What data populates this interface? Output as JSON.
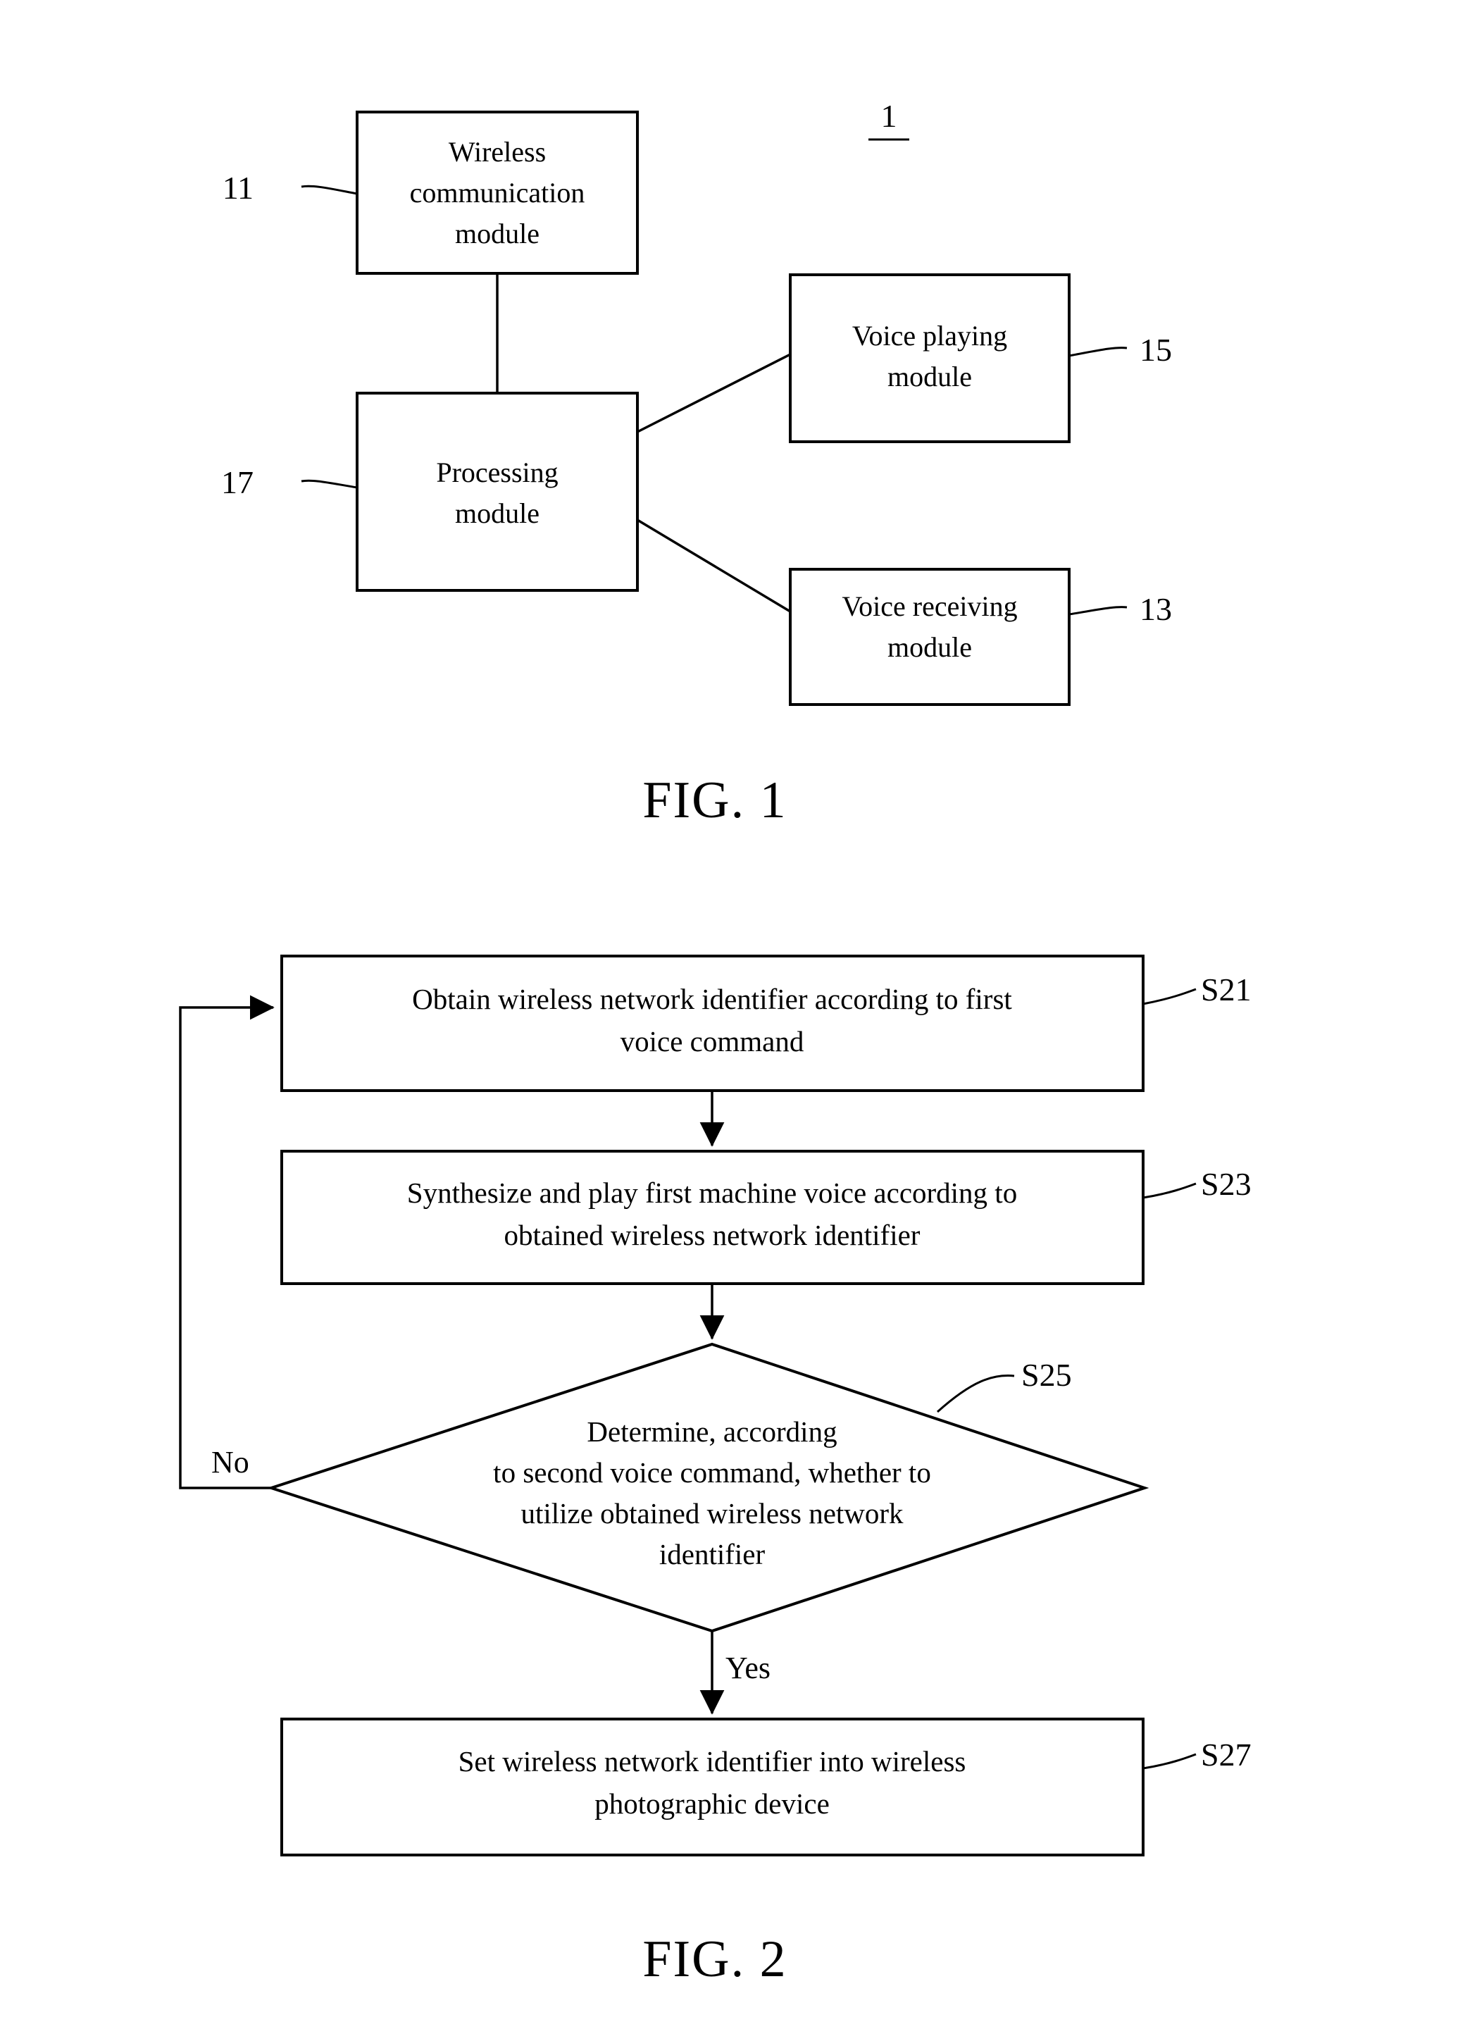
{
  "figures": [
    {
      "id": "fig1",
      "caption": "FIG. 1",
      "system_ref": "1",
      "blocks": [
        {
          "key": "wireless_communication_module",
          "label_line1": "Wireless",
          "label_line2": "communication",
          "label_line3": "module",
          "ref": "11"
        },
        {
          "key": "processing_module",
          "label_line1": "Processing",
          "label_line2": "module",
          "ref": "17"
        },
        {
          "key": "voice_playing_module",
          "label_line1": "Voice playing",
          "label_line2": "module",
          "ref": "15"
        },
        {
          "key": "voice_receiving_module",
          "label_line1": "Voice receiving",
          "label_line2": "module",
          "ref": "13"
        }
      ]
    },
    {
      "id": "fig2",
      "caption": "FIG. 2",
      "steps": [
        {
          "key": "s21",
          "ref": "S21",
          "line1": "Obtain wireless network identifier according to first",
          "line2": "voice command"
        },
        {
          "key": "s23",
          "ref": "S23",
          "line1": "Synthesize and play first machine voice according to",
          "line2": "obtained wireless network identifier"
        },
        {
          "key": "s25",
          "ref": "S25",
          "line1": "Determine, according",
          "line2": "to second voice command, whether to",
          "line3": "utilize obtained wireless network",
          "line4": "identifier"
        },
        {
          "key": "s27",
          "ref": "S27",
          "line1": "Set wireless network identifier into wireless",
          "line2": "photographic device"
        }
      ],
      "branches": {
        "no_label": "No",
        "yes_label": "Yes"
      }
    }
  ],
  "colors": {
    "ink": "#000000",
    "paper": "#ffffff"
  }
}
